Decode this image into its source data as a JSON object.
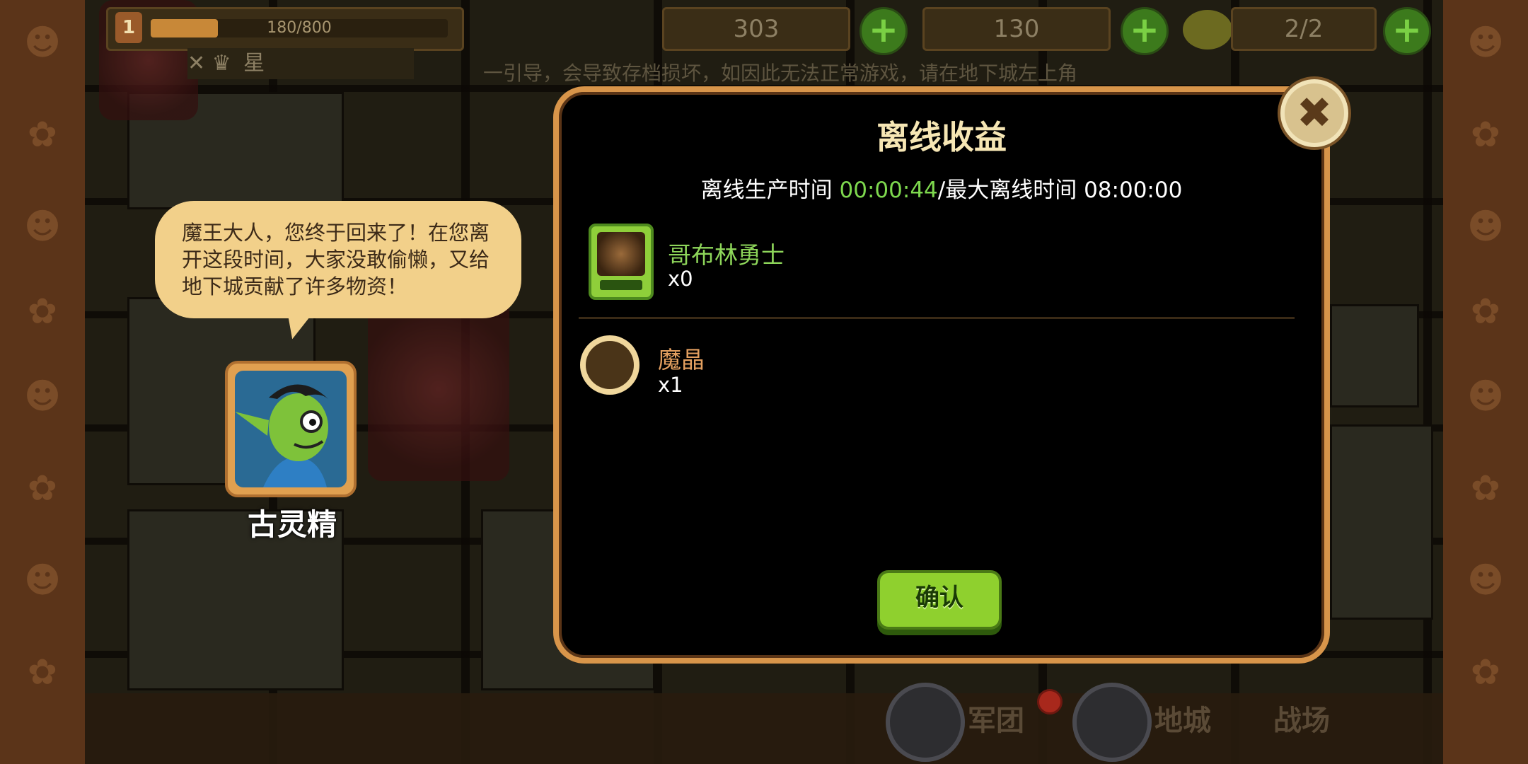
{
  "topbar": {
    "level": "1",
    "xp_text": "180/800",
    "xp_fraction": 0.225,
    "resource1": "303",
    "resource2": "130",
    "resource3": "2/2",
    "plus": "+"
  },
  "subbar": {
    "star_label": "星"
  },
  "marquee": "一引导，会导致存档损坏，如因此无法正常游戏，请在地下城左上角",
  "npc": {
    "speech": "魔王大人，您终于回来了！在您离开这段时间，大家没敢偷懒，又给地下城贡献了许多物资！",
    "name": "古灵精"
  },
  "modal": {
    "title": "离线收益",
    "offline_label": "离线生产时间",
    "offline_time": "00:00:44",
    "max_label": "/最大离线时间",
    "max_time": "08:00:00",
    "close": "✖",
    "confirm": "确认"
  },
  "rewards": [
    {
      "name": "哥布林勇士",
      "count": "x0",
      "name_color": "#8ed65a"
    },
    {
      "name": "魔晶",
      "count": "x1",
      "name_color": "#e4a060"
    }
  ],
  "bottom": {
    "army": "军团",
    "dungeon": "地城",
    "battle": "战场"
  },
  "colors": {
    "modal_border": "#d8954a",
    "confirm_green": "#8fd02e",
    "time_green": "#7ed84e"
  }
}
